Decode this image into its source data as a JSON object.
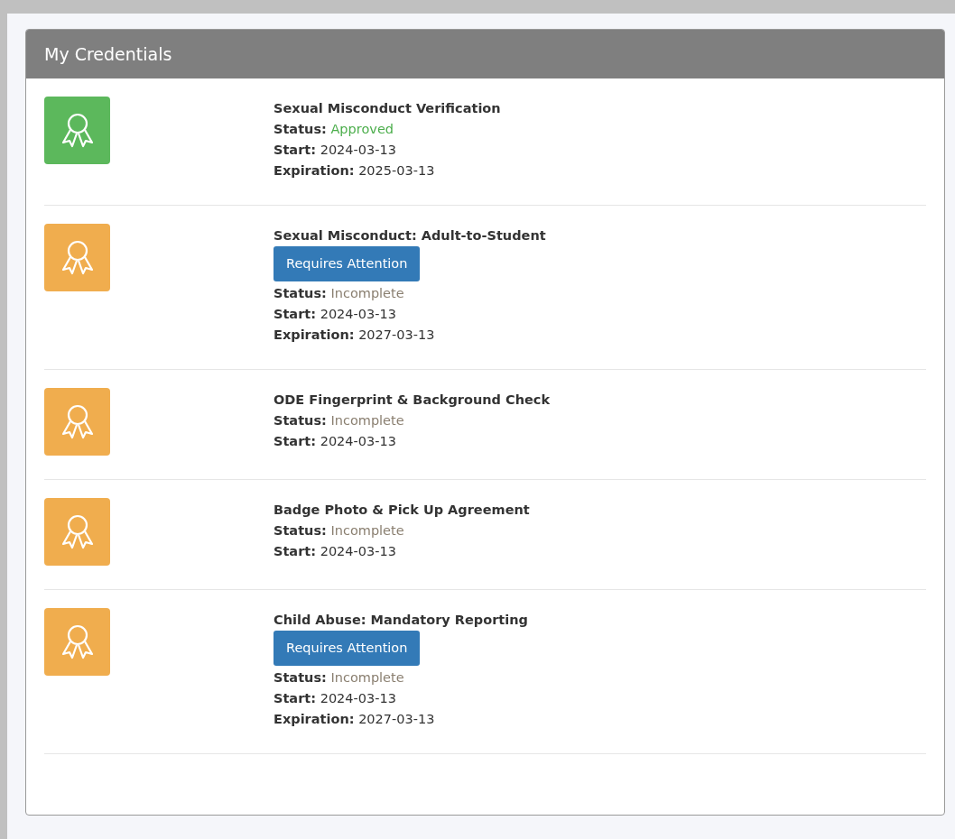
{
  "panel": {
    "title": "My Credentials"
  },
  "credentials": [
    {
      "title": "Sexual Misconduct Verification",
      "approved": true,
      "fields": [
        {
          "label": "Status:",
          "value": "Approved",
          "kind": "status"
        },
        {
          "label": "Start:",
          "value": "2024-03-13",
          "kind": "date"
        },
        {
          "label": "Expiration:",
          "value": "2025-03-13",
          "kind": "date"
        }
      ]
    },
    {
      "title": "Sexual Misconduct: Adult-to-Student",
      "approved": false,
      "button": "Requires Attention",
      "fields": [
        {
          "label": "Status:",
          "value": "Incomplete",
          "kind": "status"
        },
        {
          "label": "Start:",
          "value": "2024-03-13",
          "kind": "date"
        },
        {
          "label": "Expiration:",
          "value": "2027-03-13",
          "kind": "date"
        }
      ]
    },
    {
      "title": "ODE Fingerprint & Background Check",
      "approved": false,
      "fields": [
        {
          "label": "Status:",
          "value": "Incomplete",
          "kind": "status"
        },
        {
          "label": "Start:",
          "value": "2024-03-13",
          "kind": "date"
        }
      ]
    },
    {
      "title": "Badge Photo & Pick Up Agreement",
      "approved": false,
      "fields": [
        {
          "label": "Status:",
          "value": "Incomplete",
          "kind": "status"
        },
        {
          "label": "Start:",
          "value": "2024-03-13",
          "kind": "date"
        }
      ]
    },
    {
      "title": "Child Abuse: Mandatory Reporting",
      "approved": false,
      "button": "Requires Attention",
      "fields": [
        {
          "label": "Status:",
          "value": "Incomplete",
          "kind": "status"
        },
        {
          "label": "Start:",
          "value": "2024-03-13",
          "kind": "date"
        },
        {
          "label": "Expiration:",
          "value": "2027-03-13",
          "kind": "date"
        }
      ]
    }
  ]
}
